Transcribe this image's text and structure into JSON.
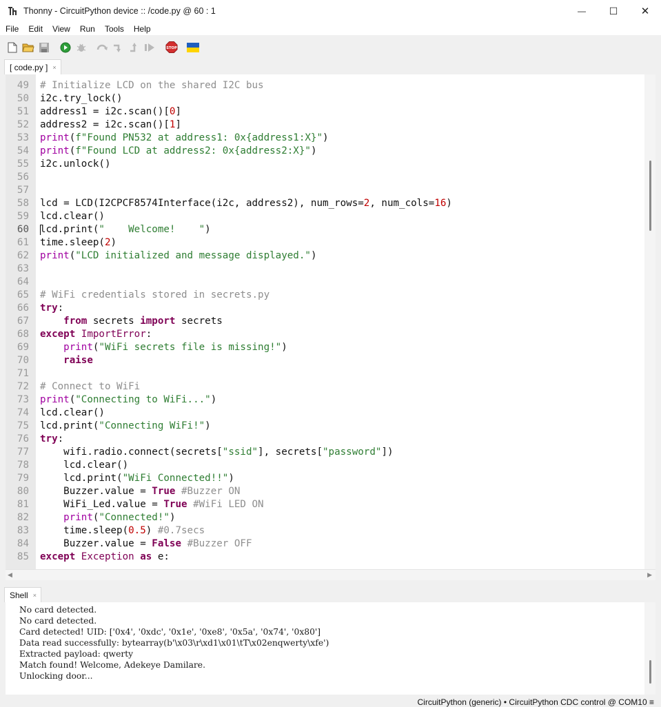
{
  "window": {
    "title": "Thonny  -  CircuitPython device :: /code.py  @  60 : 1",
    "minimize_glyph": "—",
    "maximize_glyph": "☐",
    "close_glyph": "✕"
  },
  "menu": {
    "items": [
      "File",
      "Edit",
      "View",
      "Run",
      "Tools",
      "Help"
    ]
  },
  "toolbar": {
    "buttons": [
      {
        "name": "new-file-button",
        "icon": "new-file-icon"
      },
      {
        "name": "open-file-button",
        "icon": "folder-open-icon"
      },
      {
        "name": "save-file-button",
        "icon": "save-icon"
      },
      {
        "name": "run-button",
        "icon": "play-icon"
      },
      {
        "name": "debug-button",
        "icon": "bug-icon"
      },
      {
        "name": "step-over-button",
        "icon": "step-over-icon"
      },
      {
        "name": "step-into-button",
        "icon": "step-into-icon"
      },
      {
        "name": "step-out-button",
        "icon": "step-out-icon"
      },
      {
        "name": "resume-button",
        "icon": "resume-icon"
      },
      {
        "name": "stop-button",
        "icon": "stop-icon",
        "label": "STOP"
      },
      {
        "name": "ukraine-flag-button",
        "icon": "flag-icon"
      }
    ],
    "colors": {
      "run": "#2e9e3a",
      "stop": "#d32f2f",
      "flag_blue": "#1f5fbf",
      "flag_yellow": "#ffd400"
    }
  },
  "editor": {
    "tab_label": "[ code.py ]",
    "tab_close": "×",
    "current_line": 60,
    "lines": [
      {
        "n": "49",
        "tokens": [
          [
            "cm",
            "# Initialize LCD on the shared I2C bus"
          ]
        ]
      },
      {
        "n": "50",
        "tokens": [
          [
            "",
            "i2c.try_lock()"
          ]
        ]
      },
      {
        "n": "51",
        "tokens": [
          [
            "",
            "address1 = i2c.scan()["
          ],
          [
            "nm",
            "0"
          ],
          [
            "",
            "]"
          ]
        ]
      },
      {
        "n": "52",
        "tokens": [
          [
            "",
            "address2 = i2c.scan()["
          ],
          [
            "nm",
            "1"
          ],
          [
            "",
            "]"
          ]
        ]
      },
      {
        "n": "53",
        "tokens": [
          [
            "bi",
            "print"
          ],
          [
            "",
            "("
          ],
          [
            "st",
            "f\"Found PN532 at address1: 0x{address1:X}\""
          ],
          [
            "",
            ")"
          ]
        ]
      },
      {
        "n": "54",
        "tokens": [
          [
            "bi",
            "print"
          ],
          [
            "",
            "("
          ],
          [
            "st",
            "f\"Found LCD at address2: 0x{address2:X}\""
          ],
          [
            "",
            ")"
          ]
        ]
      },
      {
        "n": "55",
        "tokens": [
          [
            "",
            "i2c.unlock()"
          ]
        ]
      },
      {
        "n": "56",
        "tokens": []
      },
      {
        "n": "57",
        "tokens": []
      },
      {
        "n": "58",
        "tokens": [
          [
            "",
            "lcd = LCD(I2CPCF8574Interface(i2c, address2), num_rows="
          ],
          [
            "nm",
            "2"
          ],
          [
            "",
            ", num_cols="
          ],
          [
            "nm",
            "16"
          ],
          [
            "",
            ")"
          ]
        ]
      },
      {
        "n": "59",
        "tokens": [
          [
            "",
            "lcd.clear()"
          ]
        ]
      },
      {
        "n": "60",
        "caret": true,
        "tokens": [
          [
            "",
            "lcd.print("
          ],
          [
            "st",
            "\"    Welcome!    \""
          ],
          [
            "",
            ")"
          ]
        ]
      },
      {
        "n": "61",
        "tokens": [
          [
            "",
            "time.sleep("
          ],
          [
            "nm",
            "2"
          ],
          [
            "",
            ")"
          ]
        ]
      },
      {
        "n": "62",
        "tokens": [
          [
            "bi",
            "print"
          ],
          [
            "",
            "("
          ],
          [
            "st",
            "\"LCD initialized and message displayed.\""
          ],
          [
            "",
            ")"
          ]
        ]
      },
      {
        "n": "63",
        "tokens": []
      },
      {
        "n": "64",
        "tokens": []
      },
      {
        "n": "65",
        "tokens": [
          [
            "cm",
            "# WiFi credentials stored in secrets.py"
          ]
        ]
      },
      {
        "n": "66",
        "tokens": [
          [
            "kw",
            "try"
          ],
          [
            "",
            ":"
          ]
        ]
      },
      {
        "n": "67",
        "tokens": [
          [
            "",
            "    "
          ],
          [
            "kw",
            "from"
          ],
          [
            "",
            " secrets "
          ],
          [
            "kw",
            "import"
          ],
          [
            "",
            " secrets"
          ]
        ]
      },
      {
        "n": "68",
        "tokens": [
          [
            "kw",
            "except"
          ],
          [
            "",
            " "
          ],
          [
            "ex",
            "ImportError"
          ],
          [
            "",
            ":"
          ]
        ]
      },
      {
        "n": "69",
        "tokens": [
          [
            "",
            "    "
          ],
          [
            "bi",
            "print"
          ],
          [
            "",
            "("
          ],
          [
            "st",
            "\"WiFi secrets file is missing!\""
          ],
          [
            "",
            ")"
          ]
        ]
      },
      {
        "n": "70",
        "tokens": [
          [
            "",
            "    "
          ],
          [
            "kw",
            "raise"
          ]
        ]
      },
      {
        "n": "71",
        "tokens": []
      },
      {
        "n": "72",
        "tokens": [
          [
            "cm",
            "# Connect to WiFi"
          ]
        ]
      },
      {
        "n": "73",
        "tokens": [
          [
            "bi",
            "print"
          ],
          [
            "",
            "("
          ],
          [
            "st",
            "\"Connecting to WiFi...\""
          ],
          [
            "",
            ")"
          ]
        ]
      },
      {
        "n": "74",
        "tokens": [
          [
            "",
            "lcd.clear()"
          ]
        ]
      },
      {
        "n": "75",
        "tokens": [
          [
            "",
            "lcd.print("
          ],
          [
            "st",
            "\"Connecting WiFi!\""
          ],
          [
            "",
            ")"
          ]
        ]
      },
      {
        "n": "76",
        "tokens": [
          [
            "kw",
            "try"
          ],
          [
            "",
            ":"
          ]
        ]
      },
      {
        "n": "77",
        "tokens": [
          [
            "",
            "    wifi.radio.connect(secrets["
          ],
          [
            "st",
            "\"ssid\""
          ],
          [
            "",
            "], secrets["
          ],
          [
            "st",
            "\"password\""
          ],
          [
            "",
            "])"
          ]
        ]
      },
      {
        "n": "78",
        "tokens": [
          [
            "",
            "    lcd.clear()"
          ]
        ]
      },
      {
        "n": "79",
        "tokens": [
          [
            "",
            "    lcd.print("
          ],
          [
            "st",
            "\"WiFi Connected!!\""
          ],
          [
            "",
            ")"
          ]
        ]
      },
      {
        "n": "80",
        "tokens": [
          [
            "",
            "    Buzzer.value = "
          ],
          [
            "kw",
            "True"
          ],
          [
            "",
            " "
          ],
          [
            "cm",
            "#Buzzer ON"
          ]
        ]
      },
      {
        "n": "81",
        "tokens": [
          [
            "",
            "    WiFi_Led.value = "
          ],
          [
            "kw",
            "True"
          ],
          [
            "",
            " "
          ],
          [
            "cm",
            "#WiFi LED ON"
          ]
        ]
      },
      {
        "n": "82",
        "tokens": [
          [
            "",
            "    "
          ],
          [
            "bi",
            "print"
          ],
          [
            "",
            "("
          ],
          [
            "st",
            "\"Connected!\""
          ],
          [
            "",
            ")"
          ]
        ]
      },
      {
        "n": "83",
        "tokens": [
          [
            "",
            "    time.sleep("
          ],
          [
            "nm",
            "0.5"
          ],
          [
            "",
            ") "
          ],
          [
            "cm",
            "#0.7secs"
          ]
        ]
      },
      {
        "n": "84",
        "tokens": [
          [
            "",
            "    Buzzer.value = "
          ],
          [
            "kw",
            "False"
          ],
          [
            "",
            " "
          ],
          [
            "cm",
            "#Buzzer OFF"
          ]
        ]
      },
      {
        "n": "85",
        "tokens": [
          [
            "kw",
            "except"
          ],
          [
            "",
            " "
          ],
          [
            "ex",
            "Exception"
          ],
          [
            "",
            " "
          ],
          [
            "kw",
            "as"
          ],
          [
            "",
            " e:"
          ]
        ]
      }
    ]
  },
  "shell": {
    "tab_label": "Shell",
    "tab_close": "×",
    "lines": [
      "No card detected.",
      "No card detected.",
      "Card detected! UID: ['0x4', '0xdc', '0x1e', '0xe8', '0x5a', '0x74', '0x80']",
      "Data read successfully: bytearray(b'\\x03\\r\\xd1\\x01\\tT\\x02enqwerty\\xfe')",
      "Extracted payload: qwerty",
      "Match found! Welcome, Adekeye Damilare.",
      "Unlocking door..."
    ]
  },
  "status": {
    "text": "CircuitPython (generic)  •  CircuitPython CDC control @ COM10  ≡"
  }
}
